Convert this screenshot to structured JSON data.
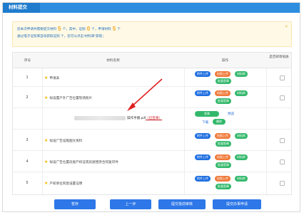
{
  "header": {
    "title": "材料提交"
  },
  "notice": {
    "line1_prefix": "您本次申请共需要提交材料",
    "total": "5",
    "line1_mid1": "个，其中，证照",
    "license": "0",
    "line1_mid2": "个，申请材料",
    "material": "5",
    "line1_suffix": "个",
    "line2": "通过电子证照库自动获取证照 个，您可以点击“材料库”获取；",
    "close": "×"
  },
  "table": {
    "headers": {
      "seq": "序号",
      "name": "材料名称",
      "ops": "操作",
      "mail": "是否邮寄纸质"
    },
    "rows": [
      {
        "seq": "1",
        "name": "申请表"
      },
      {
        "seq": "2",
        "name": "拟设置户外广告位置现场照片"
      },
      {
        "seq": "3",
        "name": "拟设广告设施图文资料"
      },
      {
        "seq": "4",
        "name": "拟设广告位置房屋产权证或房屋租赁合同复印件"
      },
      {
        "seq": "5",
        "name": "产权单位同意设置证明"
      }
    ],
    "file": {
      "name": "操作手册.pdf",
      "status": "（已签章）",
      "sign": "签章",
      "preview": "预览",
      "download": "下载",
      "delete": "删除"
    },
    "buttons": {
      "upload": "附件上传",
      "photo": "拍照上传",
      "library": "材料库",
      "batch_sign": "批量签章"
    }
  },
  "footer": {
    "save": "暂存",
    "prev": "上一步",
    "batch_submit": "提交批前审核",
    "submit": "提交办事申请"
  },
  "colors": {
    "brand": "#2d8ee0",
    "accent": "#f5a623",
    "button": "#2d77e8"
  }
}
